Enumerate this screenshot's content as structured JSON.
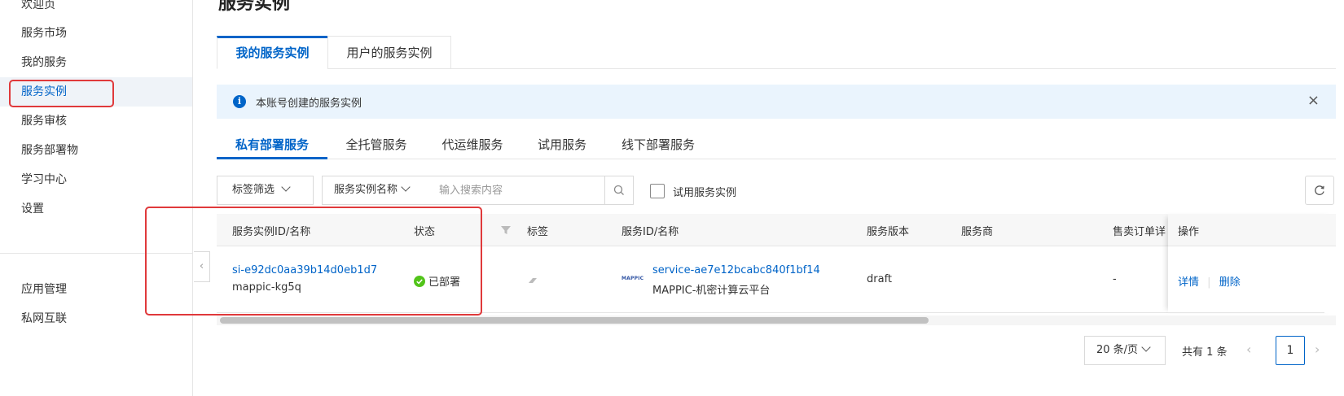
{
  "page": {
    "title": "服务实例"
  },
  "sidebar": {
    "items": [
      {
        "label": "欢迎页"
      },
      {
        "label": "服务市场"
      },
      {
        "label": "我的服务"
      },
      {
        "label": "服务实例"
      },
      {
        "label": "服务审核"
      },
      {
        "label": "服务部署物"
      },
      {
        "label": "学习中心"
      },
      {
        "label": "设置"
      },
      {
        "label": "应用管理"
      },
      {
        "label": "私网互联"
      }
    ],
    "active": "服务实例"
  },
  "main_tabs": [
    {
      "label": "我的服务实例"
    },
    {
      "label": "用户的服务实例"
    }
  ],
  "banner": {
    "text": "本账号创建的服务实例",
    "icon": "info-icon",
    "close": "×"
  },
  "sub_tabs": [
    {
      "label": "私有部署服务"
    },
    {
      "label": "全托管服务"
    },
    {
      "label": "代运维服务"
    },
    {
      "label": "试用服务"
    },
    {
      "label": "线下部署服务"
    }
  ],
  "toolbar": {
    "tag_filter": "标签筛选",
    "search_field_select": "服务实例名称",
    "search_placeholder": "输入搜索内容",
    "trial_checkbox_label": "试用服务实例"
  },
  "table": {
    "columns": [
      "服务实例ID/名称",
      "状态",
      "标签",
      "服务ID/名称",
      "服务版本",
      "服务商",
      "售卖订单详",
      "操作"
    ],
    "rows": [
      {
        "instance_id": "si-e92dc0aa39b14d0eb1d7",
        "instance_name": "mappic-kg5q",
        "status": "已部署",
        "service_logo": "MAPPIC",
        "service_id": "service-ae7e12bcabc840f1bf14",
        "service_name": "MAPPIC-机密计算云平台",
        "version": "draft",
        "provider": "",
        "order_detail": "-",
        "actions": [
          "详情",
          "删除"
        ]
      }
    ]
  },
  "pagination": {
    "page_size": "20 条/页",
    "total": "共有 1 条",
    "current_page": "1"
  },
  "colors": {
    "accent": "#0064c8",
    "highlight": "#e0393b",
    "success": "#52c41a"
  }
}
